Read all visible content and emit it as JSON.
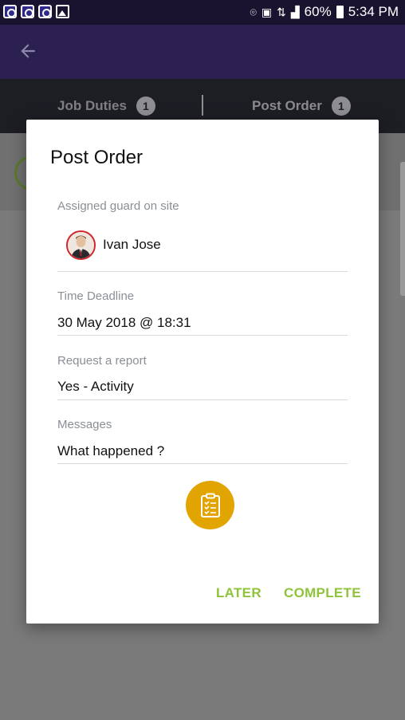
{
  "status_bar": {
    "battery_percent": "60%",
    "time": "5:34 PM",
    "icons_left": [
      "app-notification-icon",
      "app-notification-icon",
      "app-notification-icon",
      "image-icon"
    ],
    "icons_right": [
      "location-icon",
      "nfc-icon",
      "data-icon",
      "signal-icon",
      "battery-icon"
    ]
  },
  "app_bar": {
    "back_icon": "back-arrow-icon"
  },
  "tabs": [
    {
      "label": "Job Duties",
      "count": "1"
    },
    {
      "label": "Post Order",
      "count": "1"
    }
  ],
  "dialog": {
    "title": "Post Order",
    "fields": {
      "guard": {
        "label": "Assigned guard on site",
        "value": "Ivan Jose"
      },
      "deadline": {
        "label": "Time Deadline",
        "value": "30 May 2018 @ 18:31"
      },
      "report": {
        "label": "Request a report",
        "value": "Yes - Activity"
      },
      "messages": {
        "label": "Messages",
        "value": "What happened ?"
      }
    },
    "report_icon": "clipboard-checklist-icon",
    "actions": {
      "later": "LATER",
      "complete": "COMPLETE"
    }
  },
  "colors": {
    "status_bar": "#1a1330",
    "app_bar": "#2b2050",
    "tab_bar": "#1d1d24",
    "accent_green": "#8fc33a",
    "accent_gold": "#e2a400",
    "avatar_border": "#d0252a"
  }
}
